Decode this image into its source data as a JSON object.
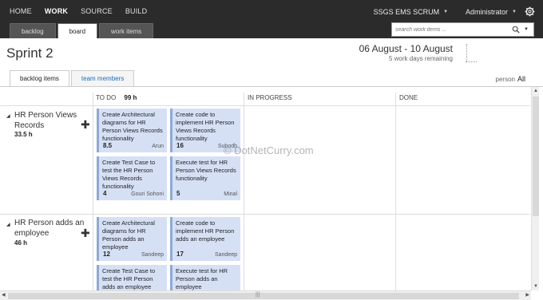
{
  "topnav": {
    "items": [
      "HOME",
      "WORK",
      "SOURCE",
      "BUILD"
    ],
    "active": "WORK"
  },
  "header": {
    "project": "SSGS EMS SCRUM",
    "user": "Administrator"
  },
  "subtabs": [
    "backlog",
    "board",
    "work items"
  ],
  "search": {
    "placeholder": "search work items ..."
  },
  "sprint": {
    "title": "Sprint 2",
    "dates": "06 August - 10 August",
    "remaining": "5 work days remaining"
  },
  "viewtabs": [
    "backlog items",
    "team members"
  ],
  "filter": {
    "label": "person",
    "value": "All"
  },
  "columns": {
    "todo": "TO DO",
    "todo_hours": "99 h",
    "inprogress": "IN PROGRESS",
    "done": "DONE"
  },
  "stories": [
    {
      "title_line1": "HR Person Views",
      "title_line2": "Records",
      "hours": "33.5 h",
      "cards": [
        {
          "title": "Create Architectural diagrams for HR Person Views Records functionality",
          "hours": "8.5",
          "owner": "Arun"
        },
        {
          "title": "Create code to implement HR Person Views Records functionality",
          "hours": "16",
          "owner": "Subodh"
        },
        {
          "title": "Create Test Case to test the HR Person Views Records functionality",
          "hours": "4",
          "owner": "Gouri Sohoni"
        },
        {
          "title": "Execute test for HR Person Views Records functionality",
          "hours": "5",
          "owner": "Minal"
        }
      ]
    },
    {
      "title_line1": "HR Person adds an",
      "title_line2": "employee",
      "hours": "46 h",
      "cards": [
        {
          "title": "Create Architectural diagrams for HR Person adds an employee",
          "hours": "12",
          "owner": "Sandeep"
        },
        {
          "title": "Create code to implement HR Person adds an employee",
          "hours": "17",
          "owner": "Sandeep"
        },
        {
          "title": "Create Test Case to test the HR Person adds an employee",
          "hours": "",
          "owner": ""
        },
        {
          "title": "Execute test for HR Person adds an employee",
          "hours": "",
          "owner": ""
        }
      ]
    }
  ],
  "watermark": "© DotNetCurry.com",
  "icons": {
    "gear": "gear-icon",
    "search": "search-icon",
    "expand": "collapse-triangle-icon",
    "add": "plus-icon"
  }
}
